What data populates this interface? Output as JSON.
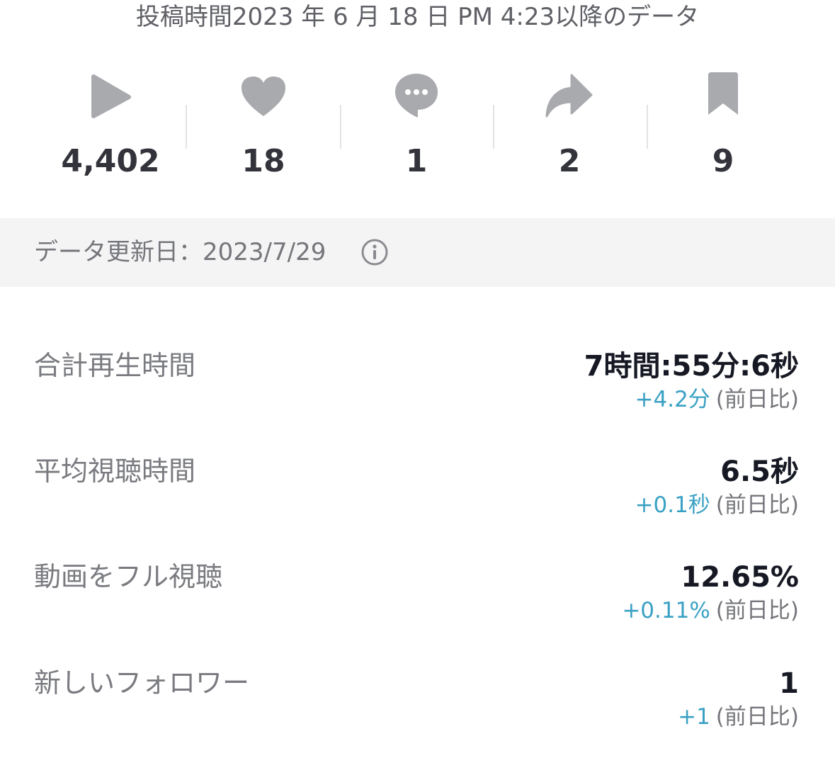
{
  "posted_since": "投稿時間2023 年 6 月 18 日 PM 4:23以降のデータ",
  "stats": [
    {
      "icon": "play-icon",
      "value": "4,402"
    },
    {
      "icon": "heart-icon",
      "value": "18"
    },
    {
      "icon": "comment-icon",
      "value": "1"
    },
    {
      "icon": "share-icon",
      "value": "2"
    },
    {
      "icon": "bookmark-icon",
      "value": "9"
    }
  ],
  "updated": {
    "text": "データ更新日：2023/7/29",
    "icon": "info-icon"
  },
  "metrics": [
    {
      "label": "合計再生時間",
      "value": "7時間:55分:6秒",
      "delta": "+4.2分",
      "compare": "(前日比)"
    },
    {
      "label": "平均視聴時間",
      "value": "6.5秒",
      "delta": "+0.1秒",
      "compare": "(前日比)"
    },
    {
      "label": "動画をフル視聴",
      "value": "12.65%",
      "delta": "+0.11%",
      "compare": "(前日比)"
    },
    {
      "label": "新しいフォロワー",
      "value": "1",
      "delta": "+1",
      "compare": "(前日比)"
    }
  ],
  "colors": {
    "icon": "#a9aaad",
    "delta": "#3aa1c4",
    "muted": "#75767b",
    "band": "#f4f4f4"
  }
}
